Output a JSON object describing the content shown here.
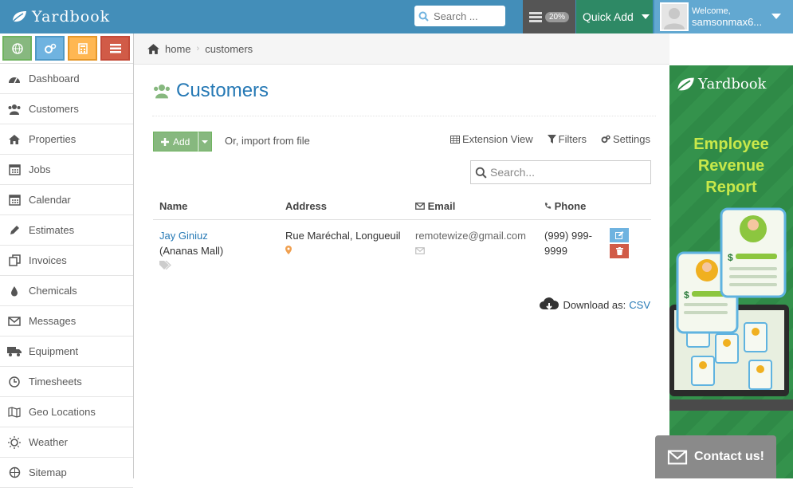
{
  "app": {
    "logo_text": "Yardbook"
  },
  "header": {
    "search_placeholder": "Search ...",
    "tasks_badge": "20%",
    "quick_add_label": "Quick Add",
    "welcome_label": "Welcome,",
    "username": "samsonmax6..."
  },
  "sidebar": {
    "shortcut_icons": [
      "globe-icon",
      "cogs-icon",
      "calculator-icon",
      "list-icon"
    ],
    "items": [
      {
        "label": "Dashboard",
        "icon": "tachometer-icon"
      },
      {
        "label": "Customers",
        "icon": "users-icon"
      },
      {
        "label": "Properties",
        "icon": "home-icon"
      },
      {
        "label": "Jobs",
        "icon": "calendar-icon"
      },
      {
        "label": "Calendar",
        "icon": "calendar-icon"
      },
      {
        "label": "Estimates",
        "icon": "pencil-icon"
      },
      {
        "label": "Invoices",
        "icon": "copy-icon"
      },
      {
        "label": "Chemicals",
        "icon": "tint-icon"
      },
      {
        "label": "Messages",
        "icon": "envelope-icon"
      },
      {
        "label": "Equipment",
        "icon": "truck-icon"
      },
      {
        "label": "Timesheets",
        "icon": "clock-icon"
      },
      {
        "label": "Geo Locations",
        "icon": "map-icon"
      },
      {
        "label": "Weather",
        "icon": "sun-icon"
      },
      {
        "label": "Sitemap",
        "icon": "sitemap-icon"
      }
    ]
  },
  "breadcrumb": {
    "home": "home",
    "current": "customers"
  },
  "page": {
    "title": "Customers",
    "add_label": "Add",
    "import_label": "Or, import from file",
    "extension_view": "Extension View",
    "filters": "Filters",
    "settings": "Settings",
    "search_placeholder": "Search..."
  },
  "table": {
    "headers": {
      "name": "Name",
      "address": "Address",
      "email": "Email",
      "phone": "Phone"
    },
    "rows": [
      {
        "name": "Jay Giniuz",
        "company": "(Ananas Mall)",
        "address": "Rue Maréchal, Longueuil",
        "email": "remotewize@gmail.com",
        "phone": "(999) 999-9999"
      }
    ]
  },
  "download": {
    "label": "Download as:",
    "format": "CSV"
  },
  "ad": {
    "logo_text": "Yardbook",
    "title_line1": "Employee",
    "title_line2": "Revenue",
    "title_line3": "Report"
  },
  "contact": {
    "label": "Contact us!"
  },
  "colors": {
    "topbar": "#438eb9",
    "quick_add": "#2e8965",
    "user": "#62a8d1",
    "link": "#2679b5",
    "add_button": "#87b87f"
  }
}
